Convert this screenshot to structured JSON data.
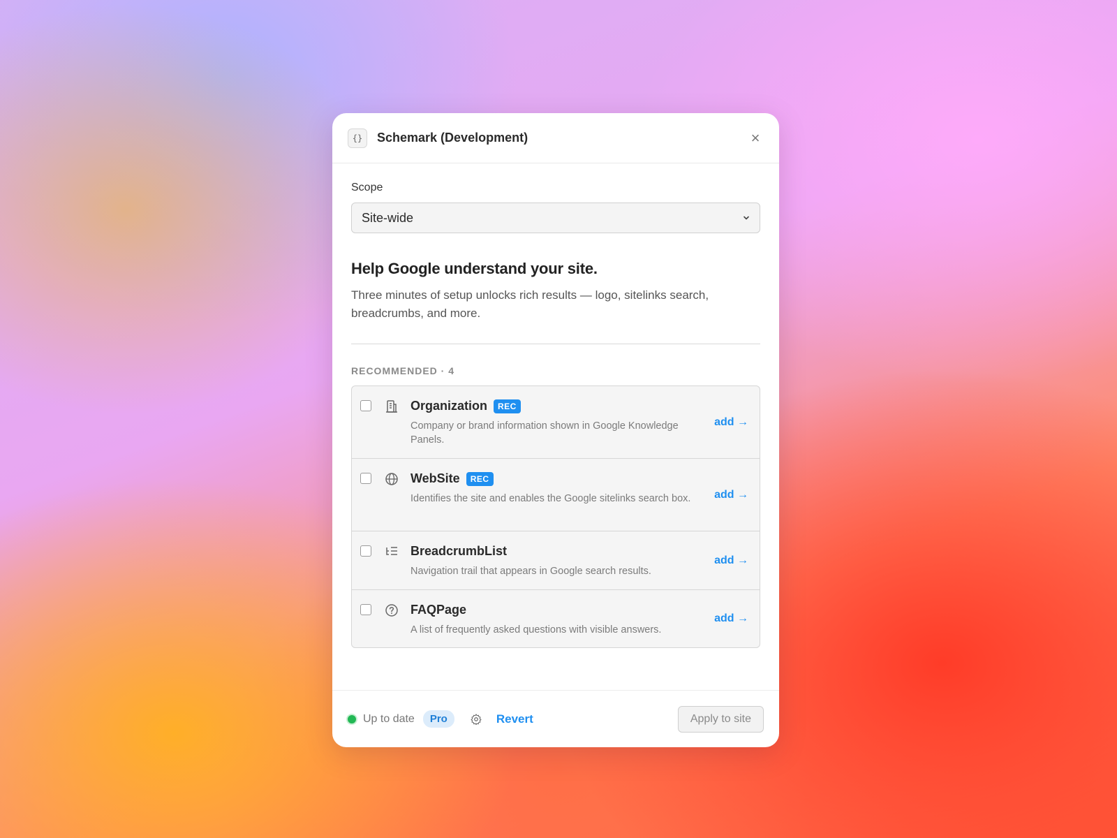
{
  "window": {
    "title": "Schemark (Development)",
    "app_icon_glyph": "{}",
    "close_glyph": "×"
  },
  "scope": {
    "label": "Scope",
    "selected": "Site-wide"
  },
  "intro": {
    "heading": "Help Google understand your site.",
    "description": "Three minutes of setup unlocks rich results — logo, sitelinks search, breadcrumbs, and more."
  },
  "recommended": {
    "section_label": "RECOMMENDED · 4",
    "items": [
      {
        "title": "Organization",
        "badge": "REC",
        "description": "Company or brand information shown in Google Knowledge Panels.",
        "action": "add →",
        "icon": "building-icon",
        "checked": false
      },
      {
        "title": "WebSite",
        "badge": "REC",
        "description": "Identifies the site and enables the Google sitelinks search box.",
        "action": "add →",
        "icon": "globe-icon",
        "checked": false
      },
      {
        "title": "BreadcrumbList",
        "badge": "",
        "description": "Navigation trail that appears in Google search results.",
        "action": "add →",
        "icon": "breadcrumb-list-icon",
        "checked": false
      },
      {
        "title": "FAQPage",
        "badge": "",
        "description": "A list of frequently asked questions with visible answers.",
        "action": "add →",
        "icon": "question-circle-icon",
        "checked": false
      }
    ]
  },
  "footer": {
    "status": "Up to date",
    "plan_badge": "Pro",
    "revert_label": "Revert",
    "apply_label": "Apply to site"
  },
  "colors": {
    "accent": "#1f8ff0",
    "status_ok": "#22b855"
  }
}
